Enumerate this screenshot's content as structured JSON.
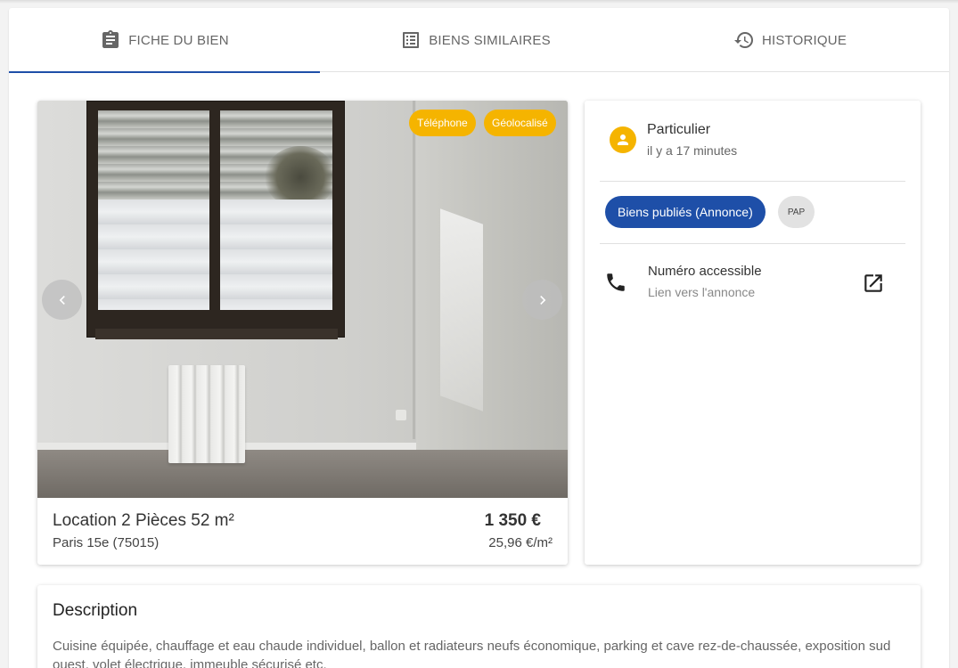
{
  "tabs": [
    {
      "label": "FICHE DU BIEN",
      "icon": "clipboard-icon",
      "active": true
    },
    {
      "label": "BIENS SIMILAIRES",
      "icon": "list-icon",
      "active": false
    },
    {
      "label": "HISTORIQUE",
      "icon": "history-icon",
      "active": false
    }
  ],
  "photo": {
    "badges": [
      "Téléphone",
      "Géolocalisé"
    ]
  },
  "listing": {
    "title": "Location 2 Pièces 52 m²",
    "location": "Paris 15e (75015)",
    "price": "1 350 €",
    "price_per_sqm": "25,96 €/m²"
  },
  "seller": {
    "type": "Particulier",
    "posted": "il y a 17 minutes"
  },
  "chips": {
    "primary": "Biens publiés (Annonce)",
    "source": "PAP"
  },
  "contact": {
    "title": "Numéro accessible",
    "subtitle": "Lien vers l'annonce"
  },
  "description": {
    "heading": "Description",
    "text": "Cuisine équipée, chauffage et eau chaude individuel, ballon et radiateurs neufs économique, parking et cave rez-de-chaussée, exposition sud ouest, volet électrique, immeuble sécurisé etc."
  },
  "colors": {
    "accent": "#1e4fa8",
    "badge": "#f5b400"
  }
}
